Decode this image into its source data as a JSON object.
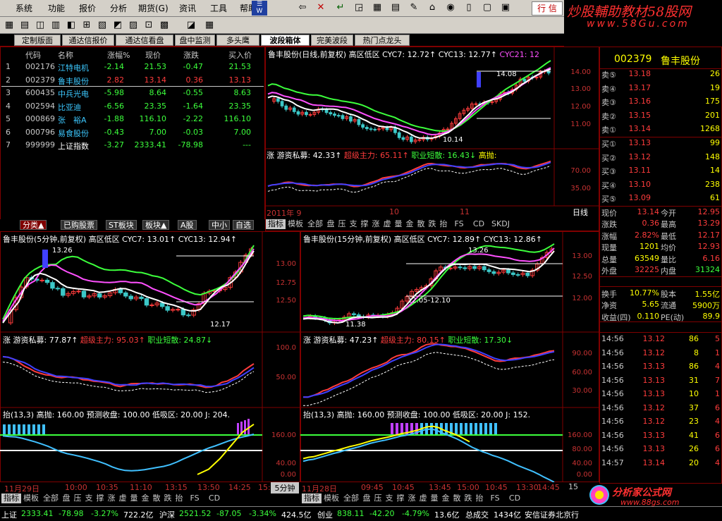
{
  "menu": [
    "系统",
    "功能",
    "报价",
    "分析",
    "期货(G)",
    "资讯",
    "工具",
    "帮助"
  ],
  "trade_label": "行 信",
  "watermark": {
    "line1": "炒股輔助教材58股网",
    "line2": "www.58Gu.com"
  },
  "tabs": [
    "定制版面",
    "通达信报价",
    "通达信看盘",
    "盘中监测",
    "多头鹰",
    "波段箱体",
    "完美波段",
    "热门点龙头"
  ],
  "active_tab": "波段箱体",
  "watchlist": {
    "headers": [
      "代码",
      "名称",
      "涨幅%",
      "现价",
      "涨跌",
      "买入价"
    ],
    "rows": [
      {
        "idx": "1",
        "code": "002176",
        "name": "江特电机",
        "pct": "-2.14",
        "price": "21.53",
        "chg": "-0.47",
        "bid": "21.53"
      },
      {
        "idx": "2",
        "code": "002379",
        "name": "鲁丰股份",
        "pct": "2.82",
        "price": "13.14",
        "chg": "0.36",
        "bid": "13.13"
      },
      {
        "idx": "3",
        "code": "600435",
        "name": "中兵光电",
        "pct": "-5.98",
        "price": "8.64",
        "chg": "-0.55",
        "bid": "8.63"
      },
      {
        "idx": "4",
        "code": "002594",
        "name": "比亚迪",
        "pct": "-6.56",
        "price": "23.35",
        "chg": "-1.64",
        "bid": "23.35"
      },
      {
        "idx": "5",
        "code": "000869",
        "name": "张　裕A",
        "pct": "-1.88",
        "price": "116.10",
        "chg": "-2.22",
        "bid": "116.10"
      },
      {
        "idx": "6",
        "code": "000796",
        "name": "易食股份",
        "pct": "-0.43",
        "price": "7.00",
        "chg": "-0.03",
        "bid": "7.00"
      },
      {
        "idx": "7",
        "code": "999999",
        "name": "上证指数",
        "pct": "-3.27",
        "price": "2333.41",
        "chg": "-78.98",
        "bid": "---"
      }
    ]
  },
  "class_tabs": [
    "分类▲",
    "已购股票",
    "ST板块",
    "板块▲",
    "A股",
    "中小",
    "自选"
  ],
  "daily": {
    "title": "鲁丰股份(日线,前复权) 高区低区",
    "cyc7": "CYC7: 12.72↑",
    "cyc13": "CYC13: 12.77↑",
    "cyc21": "CYC21: 12",
    "hi_lbl": "14.08",
    "lo_lbl": "10.14",
    "axis": [
      "14.00",
      "13.00",
      "12.00",
      "11.00"
    ],
    "ind_name": "涨 游资私募: 42.33↑",
    "ind_a": "超级主力: 65.11↑",
    "ind_b": "职业短散: 16.43↓",
    "ind_c": "高抛:",
    "ind_axis": [
      "70.00",
      "35.00"
    ],
    "xlabels": [
      "2011年 9",
      "10",
      "11"
    ],
    "period": "日线"
  },
  "min5": {
    "title": "鲁丰股份(5分钟,前复权) 高区低区",
    "cyc7": "CYC7: 13.01↑",
    "cyc13": "CYC13: 12.94↑",
    "hi_lbl": "13.26",
    "lo_lbl": "12.17",
    "axis": [
      "13.00",
      "12.75",
      "12.50"
    ],
    "ind_name": "涨 游资私募: 77.87↑",
    "ind_a": "超级主力: 95.03↑",
    "ind_b": "职业短散: 24.87↓",
    "ind_axis": [
      "100.0",
      "50.00"
    ],
    "ind2": "抬(13,3) 高抛: 160.00 预测收盘: 100.00 低吸区: 20.00 J: 204.",
    "ind2_axis": [
      "160.00",
      "40.00",
      "0.00"
    ],
    "xlabels": [
      "11月29日",
      "10:00",
      "10:35",
      "11:10",
      "13:15",
      "13:50",
      "14:25",
      "15:00"
    ],
    "period": "5分钟"
  },
  "min15": {
    "title": "鲁丰股份(15分钟,前复权) 高区低区",
    "cyc7": "CYC7: 12.89↑",
    "cyc13": "CYC13: 12.86↑",
    "hi_lbl": "13.26",
    "box_lbl": "12.05-12.10",
    "lo_lbl": "11.38",
    "axis": [
      "13.00",
      "12.50",
      "12.00"
    ],
    "ind_name": "涨 游资私募: 47.23↑",
    "ind_a": "超级主力: 80.15↑",
    "ind_b": "职业短散: 17.30↓",
    "ind_axis": [
      "90.00",
      "60.00",
      "30.00"
    ],
    "ind2": "抬(13,3) 高抛: 160.00 预测收盘: 100.00 低吸区: 20.00 J: 152.",
    "ind2_axis": [
      "160.00",
      "80.00",
      "40.00",
      "0.00"
    ],
    "xlabels": [
      "11月28日",
      "09:45",
      "10:45",
      "13:45",
      "15:00",
      "10:45",
      "13:30",
      "14:45"
    ],
    "period": "15"
  },
  "bottom_tabs_left": [
    "指标",
    "模板",
    "全部",
    "盘",
    "压",
    "支",
    "撑",
    "涨",
    "虚",
    "量",
    "金",
    "散",
    "跌",
    "抬",
    "FS",
    "CD"
  ],
  "bottom_tabs_daily": [
    "指标",
    "模板",
    "全部",
    "盘",
    "压",
    "支",
    "撑",
    "涨",
    "虚",
    "量",
    "金",
    "散",
    "跌",
    "抬",
    "FS",
    "CD",
    "SKDJ"
  ],
  "quote": {
    "code": "002379",
    "name": "鲁丰股份",
    "asks": [
      [
        "卖⑤",
        "13.18",
        "26"
      ],
      [
        "卖④",
        "13.17",
        "19"
      ],
      [
        "卖③",
        "13.16",
        "175"
      ],
      [
        "卖②",
        "13.15",
        "201"
      ],
      [
        "卖①",
        "13.14",
        "1268"
      ]
    ],
    "bids": [
      [
        "买①",
        "13.13",
        "99"
      ],
      [
        "买②",
        "13.12",
        "148"
      ],
      [
        "买③",
        "13.11",
        "14"
      ],
      [
        "买④",
        "13.10",
        "238"
      ],
      [
        "买⑤",
        "13.09",
        "61"
      ]
    ],
    "stats": [
      [
        "现价",
        "13.14",
        "今开",
        "12.95"
      ],
      [
        "涨跌",
        "0.36",
        "最高",
        "13.29"
      ],
      [
        "涨幅",
        "2.82%",
        "最低",
        "12.17"
      ],
      [
        "现量",
        "1201",
        "均价",
        "12.93"
      ],
      [
        "总量",
        "63549",
        "量比",
        "6.16"
      ],
      [
        "外盘",
        "32225",
        "内盘",
        "31324"
      ]
    ],
    "fund": [
      [
        "换手",
        "10.77%",
        "股本",
        "1.55亿"
      ],
      [
        "净资",
        "5.65",
        "流通",
        "5900万"
      ],
      [
        "收益(四)",
        "0.110",
        "PE(动)",
        "89.9"
      ]
    ],
    "ticks": [
      [
        "14:56",
        "13.12",
        "86",
        "5"
      ],
      [
        "14:56",
        "13.12",
        "8",
        "1"
      ],
      [
        "14:56",
        "13.13",
        "86",
        "4"
      ],
      [
        "14:56",
        "13.13",
        "31",
        "7"
      ],
      [
        "14:56",
        "13.13",
        "10",
        "1"
      ],
      [
        "14:56",
        "13.12",
        "37",
        "6"
      ],
      [
        "14:56",
        "13.12",
        "23",
        "4"
      ],
      [
        "14:56",
        "13.13",
        "41",
        "6"
      ],
      [
        "14:56",
        "13.13",
        "26",
        "6"
      ],
      [
        "14:57",
        "13.14",
        "20",
        "4"
      ]
    ]
  },
  "status": [
    {
      "t": "上证",
      "c": "wht"
    },
    {
      "t": "2333.41",
      "c": "grn"
    },
    {
      "t": "-78.98",
      "c": "grn"
    },
    {
      "t": "-3.27%",
      "c": "grn"
    },
    {
      "t": "722.2亿",
      "c": "wht"
    },
    {
      "t": "沪深",
      "c": "wht"
    },
    {
      "t": "2521.52",
      "c": "grn"
    },
    {
      "t": "-87.05",
      "c": "grn"
    },
    {
      "t": "-3.34%",
      "c": "grn"
    },
    {
      "t": "424.5亿",
      "c": "wht"
    },
    {
      "t": "创业",
      "c": "wht"
    },
    {
      "t": "838.11",
      "c": "grn"
    },
    {
      "t": "-42.20",
      "c": "grn"
    },
    {
      "t": "-4.79%",
      "c": "grn"
    },
    {
      "t": "13.6亿",
      "c": "wht"
    },
    {
      "t": "总成交",
      "c": "wht"
    },
    {
      "t": "1434亿",
      "c": "wht"
    },
    {
      "t": "安信证券北京行",
      "c": "wht"
    }
  ],
  "logo2": {
    "line1": "分析家公式网",
    "line2": "www.88gs.com"
  }
}
